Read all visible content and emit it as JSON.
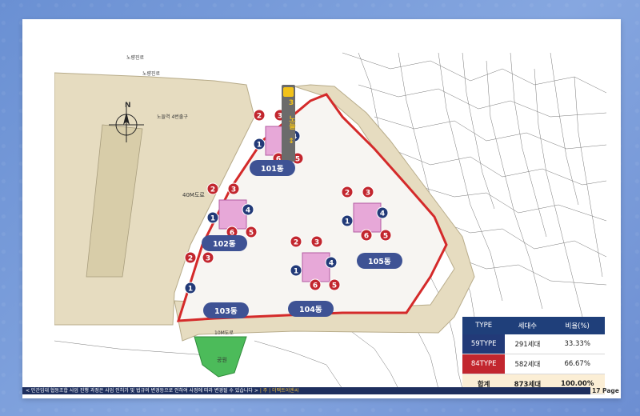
{
  "map": {
    "road_labels": [
      "노량진로",
      "노량진로",
      "40M도로",
      "10M도로"
    ],
    "station_label": "노들역 4번출구",
    "park_label": "공원",
    "north_label": "N",
    "bus_stop_text": "3 노들 ↕",
    "unit_numbers": [
      "1",
      "2",
      "3",
      "4",
      "5",
      "6"
    ],
    "buildings": [
      "101동",
      "102동",
      "103동",
      "104동",
      "105동"
    ]
  },
  "summary_table": {
    "headers": [
      "TYPE",
      "세대수",
      "비율(%)"
    ],
    "rows": [
      {
        "type": "59TYPE",
        "units": "291세대",
        "ratio": "33.33%"
      },
      {
        "type": "84TYPE",
        "units": "582세대",
        "ratio": "66.67%"
      }
    ],
    "total": {
      "type": "합계",
      "units": "873세대",
      "ratio": "100.00%"
    }
  },
  "colors": {
    "type59": "#223a78",
    "type84": "#c2262e",
    "site_border": "#d42a2a",
    "header": "#1f3f7a"
  },
  "footer": {
    "disclaimer": "< 민간임대 협동조합 사업 진행 과정은 사업 인허가 및 법규의 변경등으로 인하여 사정에 따라 변경될 수 있습니다 >",
    "source": "| 주 | 더팩트이엔씨",
    "page": "17 Page"
  }
}
